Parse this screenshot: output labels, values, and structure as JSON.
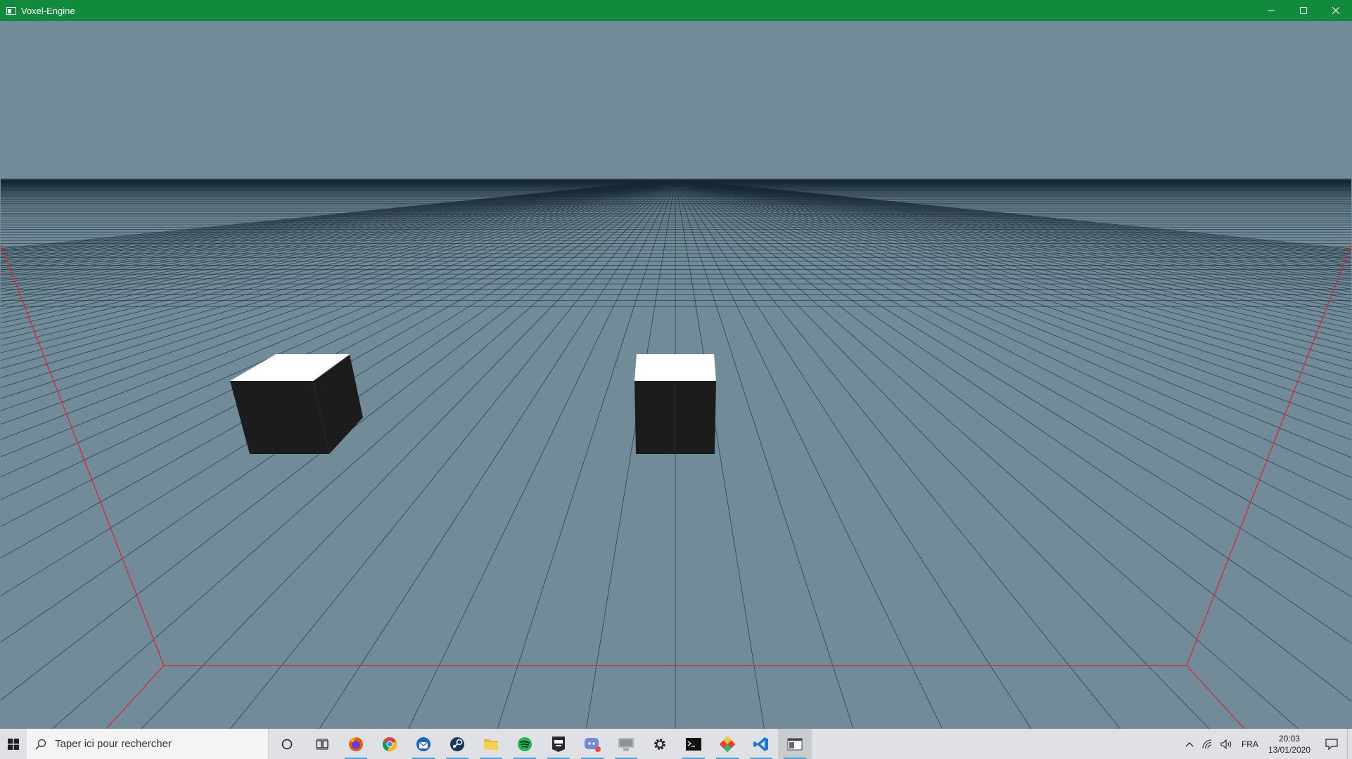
{
  "window": {
    "title": "Voxel-Engine",
    "controls": {
      "minimize_icon": "minimize-icon",
      "maximize_icon": "maximize-icon",
      "close_icon": "close-icon"
    }
  },
  "scene": {
    "background_color": "#718b99",
    "grid_color": "#1a2a33",
    "boundary_color": "#e0202a",
    "cube_top_color": "#ffffff",
    "cube_side_color": "#1c1c1c",
    "cube_count": 2
  },
  "taskbar": {
    "search_placeholder": "Taper ici pour rechercher",
    "apps": [
      {
        "name": "cortana",
        "icon": "cortana-icon"
      },
      {
        "name": "task-view",
        "icon": "task-view-icon"
      },
      {
        "name": "firefox",
        "icon": "firefox-icon",
        "running": true
      },
      {
        "name": "chrome",
        "icon": "chrome-icon"
      },
      {
        "name": "thunderbird",
        "icon": "thunderbird-icon",
        "running": true
      },
      {
        "name": "steam",
        "icon": "steam-icon",
        "running": true
      },
      {
        "name": "file-explorer",
        "icon": "folder-icon",
        "running": true
      },
      {
        "name": "spotify",
        "icon": "spotify-icon",
        "running": true
      },
      {
        "name": "epic-games",
        "icon": "epic-games-icon",
        "running": true
      },
      {
        "name": "discord",
        "icon": "discord-icon",
        "running": true
      },
      {
        "name": "remote-desktop",
        "icon": "remote-desktop-icon",
        "running": true
      },
      {
        "name": "settings",
        "icon": "gear-icon"
      },
      {
        "name": "terminal",
        "icon": "terminal-icon",
        "running": true
      },
      {
        "name": "git",
        "icon": "git-icon",
        "running": true
      },
      {
        "name": "vscode",
        "icon": "vscode-icon",
        "running": true
      },
      {
        "name": "voxel-engine",
        "icon": "window-app-icon",
        "running": true,
        "active": true
      }
    ],
    "tray": {
      "language": "FRA",
      "time": "20:03",
      "date": "13/01/2020"
    }
  }
}
